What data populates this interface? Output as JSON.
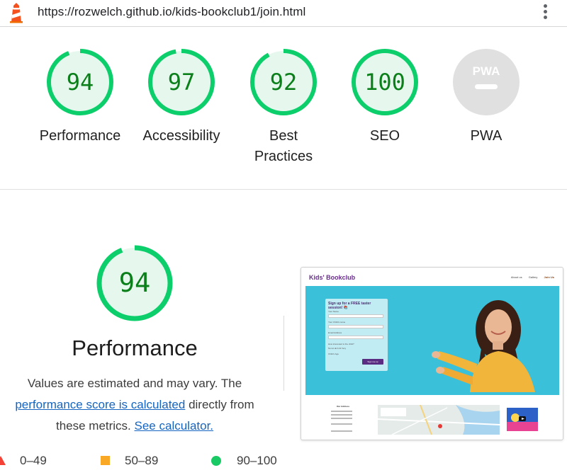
{
  "browser": {
    "url": "https://rozwelch.github.io/kids-bookclub1/join.html",
    "icons": {
      "logo": "lighthouse-icon",
      "menu": "kebab-menu-icon"
    }
  },
  "colors": {
    "pass": "#0cce6b",
    "pass_text": "#0b7f1a",
    "pass_bg": "#e6f8ee",
    "average": "#f9a825",
    "fail": "#f44336",
    "na": "#e0e0e0"
  },
  "gauges": [
    {
      "score": "94",
      "value": 0.94,
      "label": "Performance"
    },
    {
      "score": "97",
      "value": 0.97,
      "label": "Accessibility"
    },
    {
      "score": "92",
      "value": 0.92,
      "label_line1": "Best",
      "label_line2": "Practices"
    },
    {
      "score": "100",
      "value": 1.0,
      "label": "SEO"
    },
    {
      "badge": "PWA",
      "label": "PWA"
    }
  ],
  "performance": {
    "score": "94",
    "value": 0.94,
    "title": "Performance",
    "desc_before": "Values are estimated and may vary. The",
    "desc_link": "performance score is calculated",
    "desc_middle": "directly from these metrics.",
    "calc_link": "See calculator."
  },
  "legend": [
    {
      "shape": "triangle",
      "text": "0–49"
    },
    {
      "shape": "square",
      "text": "50–89"
    },
    {
      "shape": "circle",
      "text": "90–100"
    }
  ],
  "thumbnail": {
    "brand": "Kids' Bookclub",
    "nav": [
      "About us",
      "Gallery",
      "Join Us"
    ],
    "form_title": "Sign up for a FREE taster session! 📚",
    "fields": [
      "Your Name",
      "Your Child's name",
      "Email Address",
      "How interested is the child?"
    ],
    "radios": "Not at all   A bit   Very",
    "age_label": "Child's Age",
    "submit": "Sign me up",
    "footer_title": "Our Address"
  }
}
